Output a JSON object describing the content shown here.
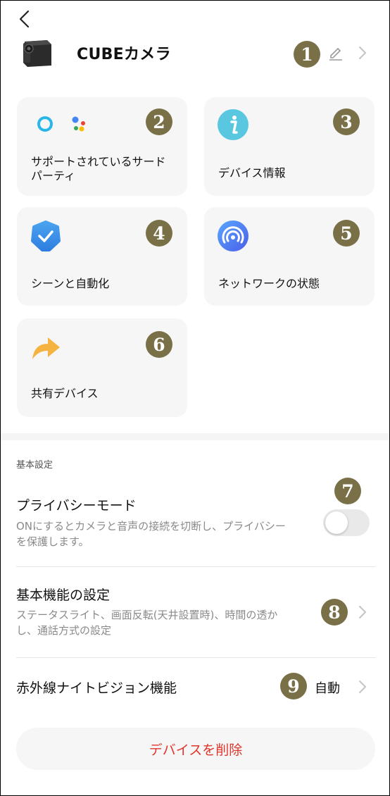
{
  "header": {
    "title": "CUBEカメラ"
  },
  "badges": [
    "1",
    "2",
    "3",
    "4",
    "5",
    "6",
    "7",
    "8",
    "9"
  ],
  "cards": [
    {
      "label": "サポートされているサードパーティ",
      "icon": "third-party-assistants-icon"
    },
    {
      "label": "デバイス情報",
      "icon": "info-icon"
    },
    {
      "label": "シーンと自動化",
      "icon": "scene-automation-check-icon"
    },
    {
      "label": "ネットワークの状態",
      "icon": "network-signal-icon"
    },
    {
      "label": "共有デバイス",
      "icon": "share-arrow-icon"
    }
  ],
  "settings": {
    "section_title": "基本設定",
    "privacy": {
      "title": "プライバシーモード",
      "desc": "ONにするとカメラと音声の接続を切断し、プライバシーを保護します。",
      "enabled": false
    },
    "basic": {
      "title": "基本機能の設定",
      "desc": "ステータスライト、画面反転(天井設置時)、時間の透かし、通話方式の設定"
    },
    "night_vision": {
      "title": "赤外線ナイトビジョン機能",
      "value": "自動"
    }
  },
  "delete_label": "デバイスを削除",
  "colors": {
    "badge": "#7a7047",
    "delete": "#e0352b",
    "card_bg": "#f6f6f6"
  }
}
